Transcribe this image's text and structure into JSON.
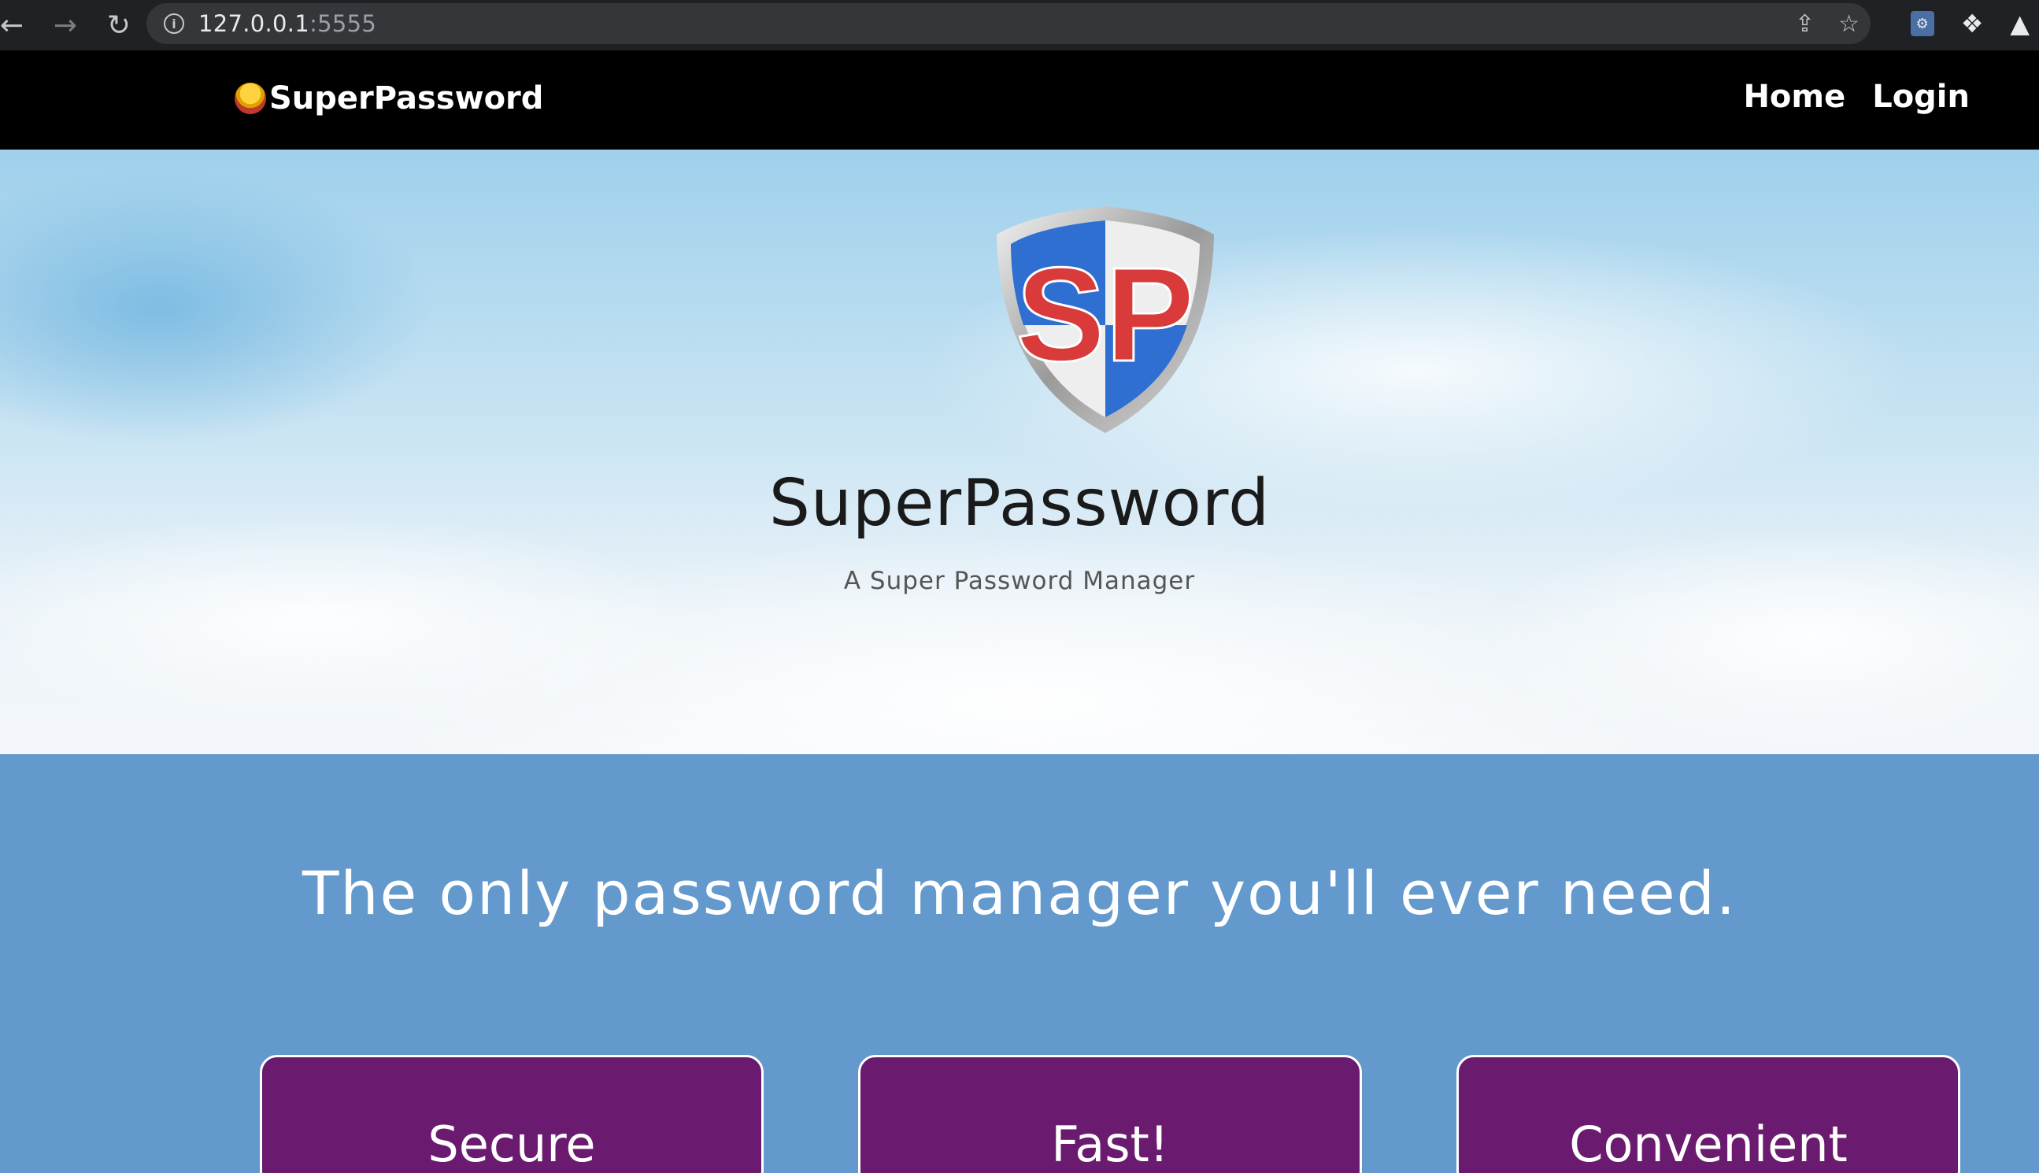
{
  "browser": {
    "url_host": "127.0.0.1",
    "url_port": ":5555",
    "icons": [
      "back-icon",
      "forward-icon",
      "reload-icon",
      "info-icon",
      "share-icon",
      "bookmark-star-icon",
      "extension-icon",
      "puzzle-icon",
      "labs-flask-icon"
    ]
  },
  "navbar": {
    "brand": "SuperPassword",
    "links": [
      "Home",
      "Login"
    ]
  },
  "hero": {
    "logo_letters": "SP",
    "title": "SuperPassword",
    "subtitle": "A Super Password Manager"
  },
  "features": {
    "tagline": "The only password manager you'll ever need.",
    "cards": [
      "Secure",
      "Fast!",
      "Convenient"
    ]
  },
  "colors": {
    "navbar_bg": "#000000",
    "section_bg": "#6399cc",
    "card_bg": "#6a1a6f",
    "logo_red": "#d93a3a",
    "logo_blue": "#2f6fd1"
  }
}
